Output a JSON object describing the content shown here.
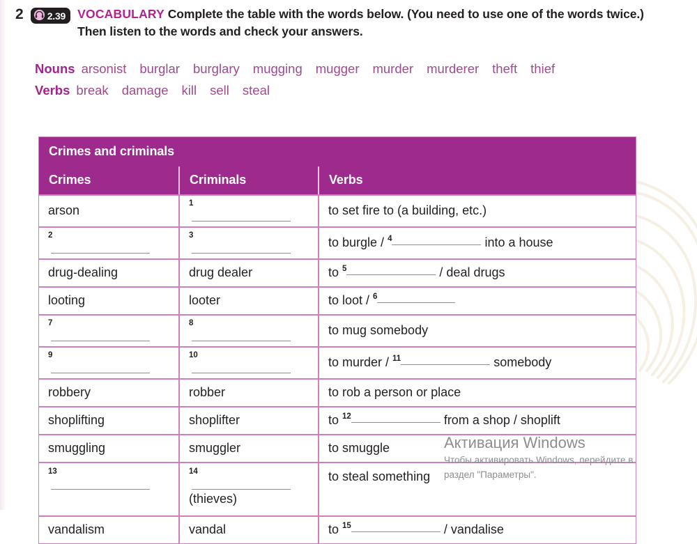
{
  "exercise": {
    "number": "2",
    "audio_badge": "2.39",
    "audio_icon": "headphones-icon",
    "vocabulary_label": "VOCABULARY",
    "instruction_line1": "Complete the table with the words below. (You need to use",
    "instruction_line2": "one of the words twice.) Then listen to the words and check your answers."
  },
  "word_bank": {
    "nouns_label": "Nouns",
    "nouns": [
      "arsonist",
      "burglar",
      "burglary",
      "mugging",
      "mugger",
      "murder",
      "murderer",
      "theft",
      "thief"
    ],
    "verbs_label": "Verbs",
    "verbs": [
      "break",
      "damage",
      "kill",
      "sell",
      "steal"
    ]
  },
  "table": {
    "caption": "Crimes and criminals",
    "headers": [
      "Crimes",
      "Criminals",
      "Verbs"
    ],
    "rows": [
      {
        "crime": "arson",
        "criminal_num": "1",
        "verb_pre": "to set fire to (a building, etc.)"
      },
      {
        "crime_num": "2",
        "criminal_num": "3",
        "verb_pre": "to burgle /",
        "verb_num": "4",
        "verb_post": "into a house"
      },
      {
        "crime": "drug-dealing",
        "criminal": "drug dealer",
        "verb_pre": "to",
        "verb_num": "5",
        "verb_post": "/ deal drugs"
      },
      {
        "crime": "looting",
        "criminal": "looter",
        "verb_pre": "to loot /",
        "verb_num": "6",
        "verb_post": ""
      },
      {
        "crime_num": "7",
        "criminal_num": "8",
        "verb_pre": "to mug somebody"
      },
      {
        "crime_num": "9",
        "criminal_num": "10",
        "verb_pre": "to murder /",
        "verb_num": "11",
        "verb_post": "somebody"
      },
      {
        "crime": "robbery",
        "criminal": "robber",
        "verb_pre": "to rob a person or place"
      },
      {
        "crime": "shoplifting",
        "criminal": "shoplifter",
        "verb_pre": "to",
        "verb_num": "12",
        "verb_post": "from a shop / shoplift"
      },
      {
        "crime": "smuggling",
        "criminal": "smuggler",
        "verb_pre": "to smuggle"
      },
      {
        "crime_num": "13",
        "criminal_num": "14",
        "criminal_note": "(thieves)",
        "verb_pre": "to steal something"
      },
      {
        "crime": "vandalism",
        "criminal": "vandal",
        "verb_pre": "to",
        "verb_num": "15",
        "verb_post": "/ vandalise"
      }
    ]
  },
  "watermark": {
    "title": "Активация Windows",
    "subtitle_line1": "Чтобы активировать Windows, перейдите в",
    "subtitle_line2": "раздел \"Параметры\"."
  },
  "colors": {
    "header_purple": "#9e2a8e",
    "border_pink": "#cf7fc0",
    "word_purple": "#9c4b8f",
    "label_magenta": "#a3228d",
    "text_dark": "#231f20",
    "watermark_grey": "#8d8d8d"
  }
}
